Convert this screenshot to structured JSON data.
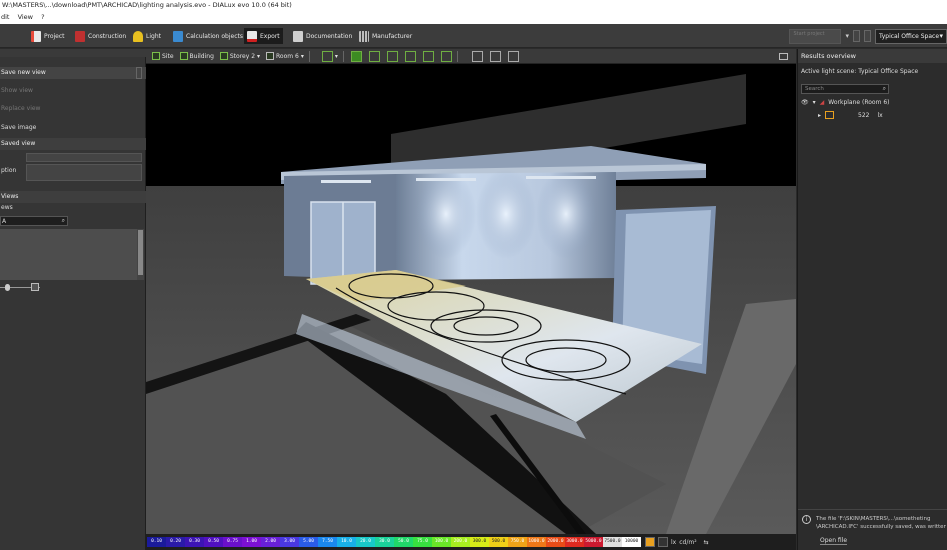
{
  "window": {
    "title": "W:\\MASTERS\\...\\download\\PMT\\ARCHICAD\\lighting analysis.evo - DIALux evo 10.0 (64 bit)"
  },
  "menu": [
    "dit",
    "View",
    "?"
  ],
  "ribbon": {
    "tabs": [
      {
        "label": "Project",
        "color": "#e84a3a"
      },
      {
        "label": "Construction",
        "color": "#c03030"
      },
      {
        "label": "Light",
        "color": "#e8c020"
      },
      {
        "label": "Calculation objects",
        "color": "#3a8ad0"
      },
      {
        "label": "Export",
        "color": "#e8e8e8"
      },
      {
        "label": "Documentation",
        "color": "#cfcfcf"
      },
      {
        "label": "Manufacturer",
        "color": "#bdbdbd"
      }
    ],
    "active_tab": "Export",
    "start_project_label": "Start project",
    "scene_select": "Typical Office Space"
  },
  "left_panel": {
    "save_view": "Save new view",
    "show_view": "Show view",
    "replace_view": "Replace view",
    "save_image": "Save image",
    "saved_view_header": "Saved view",
    "name_label": "",
    "description_label": "ption",
    "views_header": "Views",
    "views_sub": "ews",
    "search_value": "A"
  },
  "viewport_toolbar": {
    "site": "Site",
    "building": "Building",
    "storey": "Storey 2",
    "room": "Room 6"
  },
  "legend": {
    "unit": "lx",
    "unit2": "cd/m²",
    "values": [
      "0.10",
      "0.20",
      "0.30",
      "0.50",
      "0.75",
      "1.00",
      "2.00",
      "3.00",
      "5.00",
      "7.50",
      "10.0",
      "20.0",
      "30.0",
      "50.0",
      "75.0",
      "100.0",
      "200.0",
      "300.0",
      "500.0",
      "750.0",
      "1000.0",
      "2000.0",
      "3000.0",
      "5000.0",
      "7500.0",
      "10000"
    ],
    "colors": [
      "#1a1a9a",
      "#2a1aa8",
      "#3c14b4",
      "#5010c0",
      "#6a10cc",
      "#7c10d4",
      "#6820d8",
      "#4a38e0",
      "#2a5ce8",
      "#1a88ee",
      "#18b0e8",
      "#18c8c8",
      "#1ad29a",
      "#20d86a",
      "#38e040",
      "#6ae828",
      "#a8ee20",
      "#d8ec18",
      "#f0d018",
      "#f0a418",
      "#ee7818",
      "#e84c18",
      "#de2a20",
      "#cc1a30",
      "#e0e0e0",
      "#ffffff"
    ]
  },
  "results": {
    "header": "Results overview",
    "active_scene": "Active light scene: Typical Office Space",
    "search_placeholder": "Search",
    "workplane": "Workplane (Room 6)",
    "value": "522",
    "value_unit": "lx",
    "status_line1": "The file 'F:\\SKIN\\MASTERS\\...\\sometheting",
    "status_line2": "\\ARCHICAD.IFC' successfully saved, was written successfully.",
    "open_file": "Open file"
  }
}
